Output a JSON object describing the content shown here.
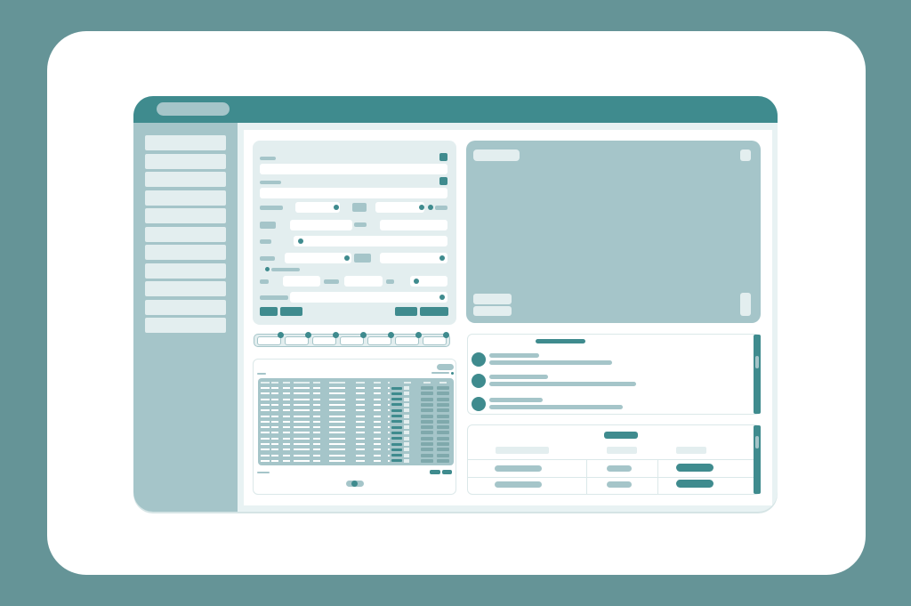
{
  "app": {
    "title": ""
  },
  "sidebar": {
    "items": [
      {
        "label": ""
      },
      {
        "label": ""
      },
      {
        "label": ""
      },
      {
        "label": ""
      },
      {
        "label": ""
      },
      {
        "label": ""
      },
      {
        "label": ""
      },
      {
        "label": ""
      },
      {
        "label": ""
      },
      {
        "label": ""
      },
      {
        "label": ""
      }
    ]
  },
  "form": {
    "submit_label": "",
    "cancel_label": "",
    "save_label": "",
    "reset_label": ""
  },
  "media": {
    "caption": ""
  },
  "list": {
    "title": "",
    "items": [
      {
        "name": ""
      },
      {
        "name": ""
      },
      {
        "name": ""
      }
    ]
  },
  "summary": {
    "title": "",
    "rows": [
      {
        "a": "",
        "b": "",
        "c": ""
      },
      {
        "a": "",
        "b": "",
        "c": ""
      }
    ]
  },
  "colors": {
    "accent": "#3f8b8e",
    "muted": "#a5c5c9",
    "light": "#e3eeef",
    "background": "#659497"
  }
}
